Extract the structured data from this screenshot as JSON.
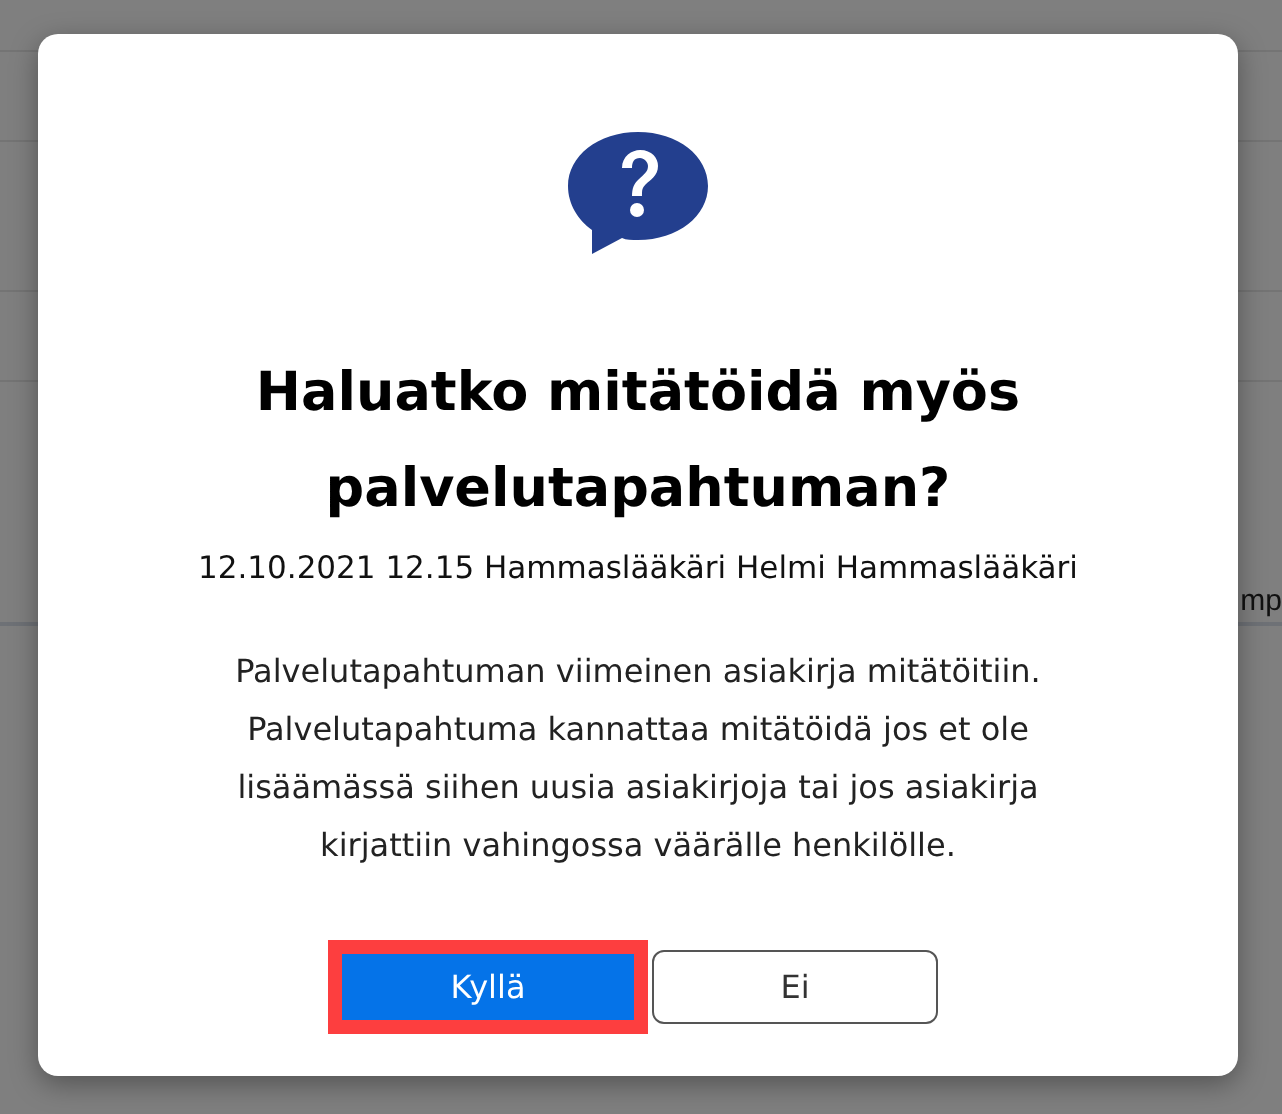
{
  "background": {
    "text_fragment": "mp"
  },
  "dialog": {
    "title": "Haluatko mitätöidä myös palvelutapahtuman?",
    "subtitle": "12.10.2021 12.15 Hammaslääkäri Helmi Hammaslääkäri",
    "message": "Palvelutapahtuman viimeinen asiakirja mitätöitiin. Palvelutapahtuma kannattaa mitätöidä jos et ole lisäämässä siihen uusia asiakirjoja tai jos asiakirja kirjattiin vahingossa väärälle henkilölle.",
    "buttons": [
      {
        "label": "Kyllä",
        "kind": "primary",
        "focused": true
      },
      {
        "label": "Ei",
        "kind": "secondary",
        "focused": false
      }
    ]
  }
}
